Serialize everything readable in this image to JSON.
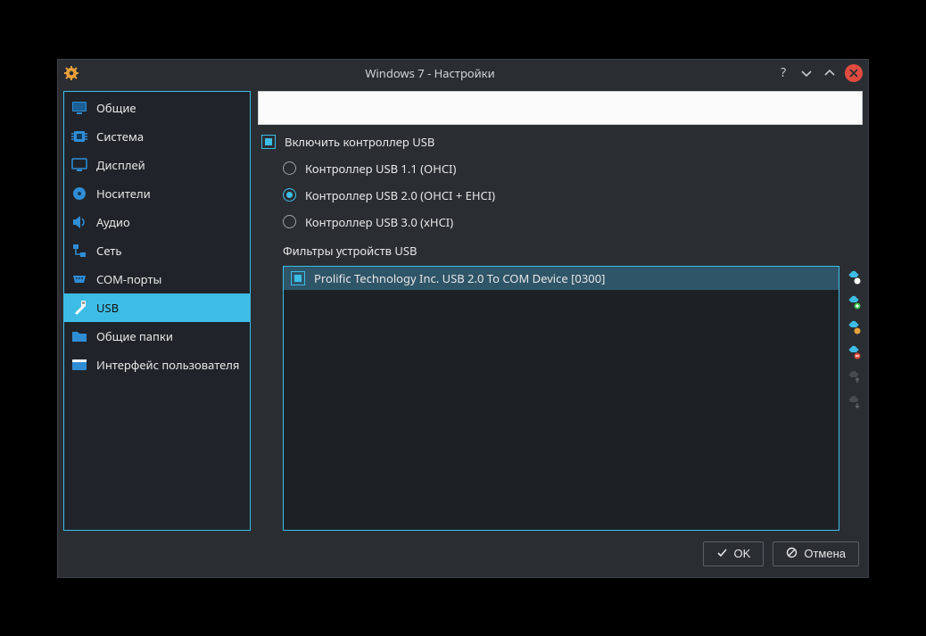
{
  "window": {
    "title": "Windows 7 - Настройки"
  },
  "sidebar": {
    "items": [
      {
        "id": "general",
        "label": "Общие"
      },
      {
        "id": "system",
        "label": "Система"
      },
      {
        "id": "display",
        "label": "Дисплей"
      },
      {
        "id": "storage",
        "label": "Носители"
      },
      {
        "id": "audio",
        "label": "Аудио"
      },
      {
        "id": "network",
        "label": "Сеть"
      },
      {
        "id": "com-ports",
        "label": "COM-порты"
      },
      {
        "id": "usb",
        "label": "USB"
      },
      {
        "id": "shared",
        "label": "Общие папки"
      },
      {
        "id": "ui",
        "label": "Интерфейс пользователя"
      }
    ],
    "selected": "usb"
  },
  "usb": {
    "enable_label": "Включить контроллер USB",
    "enable_checked": true,
    "controllers": [
      {
        "id": "usb11",
        "label": "Контроллер USB 1.1 (OHCI)",
        "selected": false
      },
      {
        "id": "usb20",
        "label": "Контроллер USB 2.0 (OHCI + EHCI)",
        "selected": true
      },
      {
        "id": "usb30",
        "label": "Контроллер USB 3.0 (xHCI)",
        "selected": false
      }
    ],
    "filters_label": "Фильтры устройств USB",
    "filters": [
      {
        "label": "Prolific Technology Inc. USB 2.0 To COM Device [0300]",
        "checked": true
      }
    ],
    "side_buttons": [
      {
        "id": "add-empty-filter",
        "enabled": true
      },
      {
        "id": "add-device-filter",
        "enabled": true
      },
      {
        "id": "edit-filter",
        "enabled": true
      },
      {
        "id": "remove-filter",
        "enabled": true
      },
      {
        "id": "move-filter-up",
        "enabled": false
      },
      {
        "id": "move-filter-down",
        "enabled": false
      }
    ]
  },
  "footer": {
    "ok": "OK",
    "cancel": "Отмена"
  },
  "colors": {
    "accent": "#3dbde6",
    "bg": "#2a2e33",
    "panel": "#20242a"
  }
}
